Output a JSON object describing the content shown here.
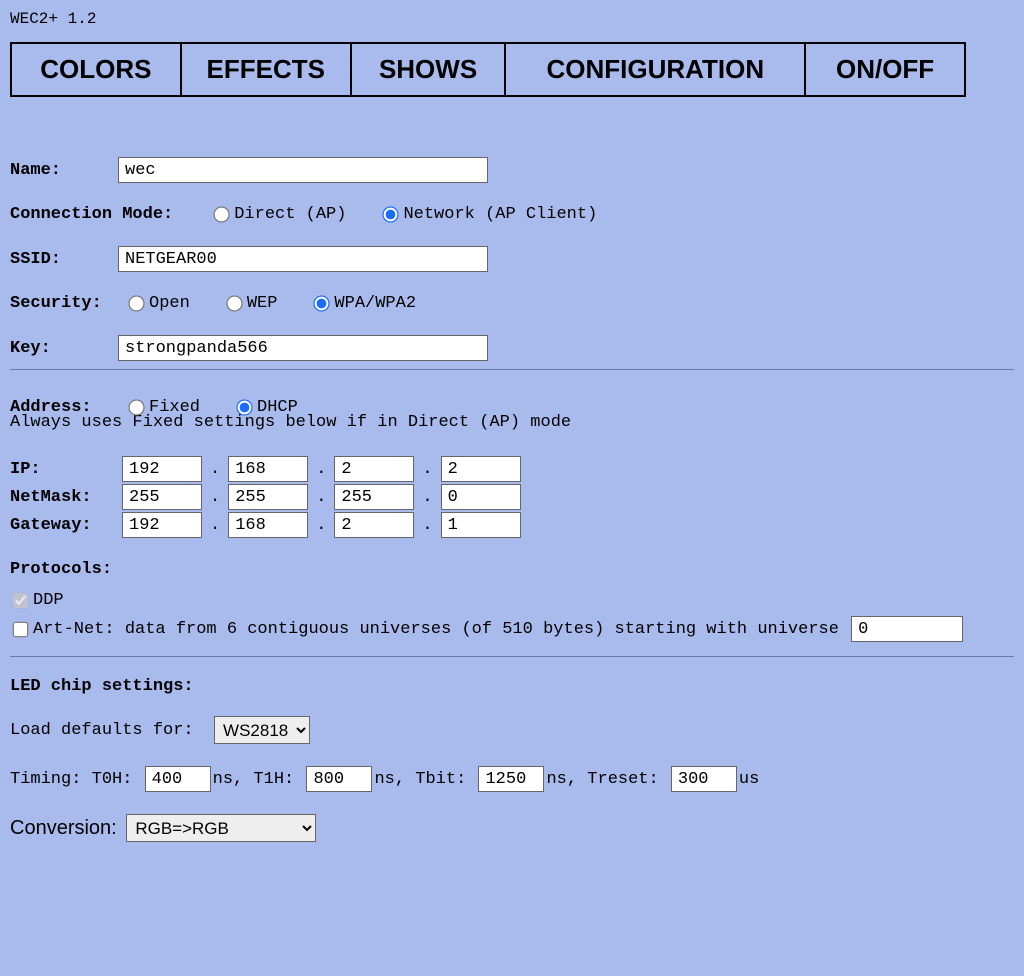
{
  "title": "WEC2+ 1.2",
  "nav": {
    "colors": "COLORS",
    "effects": "EFFECTS",
    "shows": "SHOWS",
    "configuration": "CONFIGURATION",
    "onoff": "ON/OFF"
  },
  "name": {
    "label": "Name:",
    "value": "wec"
  },
  "connection": {
    "label": "Connection Mode:",
    "direct": "Direct (AP)",
    "network": "Network (AP Client)"
  },
  "ssid": {
    "label": "SSID:",
    "value": "NETGEAR00"
  },
  "security": {
    "label": "Security:",
    "open": "Open",
    "wep": "WEP",
    "wpa": "WPA/WPA2"
  },
  "key": {
    "label": "Key:",
    "value": "strongpanda566"
  },
  "address": {
    "label": "Address:",
    "fixed": "Fixed",
    "dhcp": "DHCP",
    "note": "Always uses Fixed settings below if in Direct (AP) mode"
  },
  "ip": {
    "label": "IP:",
    "o1": "192",
    "o2": "168",
    "o3": "2",
    "o4": "2"
  },
  "netmask": {
    "label": "NetMask:",
    "o1": "255",
    "o2": "255",
    "o3": "255",
    "o4": "0"
  },
  "gateway": {
    "label": "Gateway:",
    "o1": "192",
    "o2": "168",
    "o3": "2",
    "o4": "1"
  },
  "protocols": {
    "label": "Protocols:",
    "ddp": "DDP",
    "artnet_prefix": "Art-Net: data from 6 contiguous universes (of 510 bytes) starting with universe",
    "artnet_value": "0"
  },
  "led": {
    "heading": "LED chip settings:",
    "load_defaults_label": "Load defaults for:",
    "chip_selected": "WS2818",
    "timing_label": "Timing: T0H:",
    "t0h": "400",
    "ns1": "ns, T1H:",
    "t1h": "800",
    "ns2": "ns, Tbit:",
    "tbit": "1250",
    "ns3": "ns, Treset:",
    "treset": "300",
    "us": "us",
    "conversion_label": "Conversion:",
    "conversion_selected": "RGB=>RGB"
  }
}
